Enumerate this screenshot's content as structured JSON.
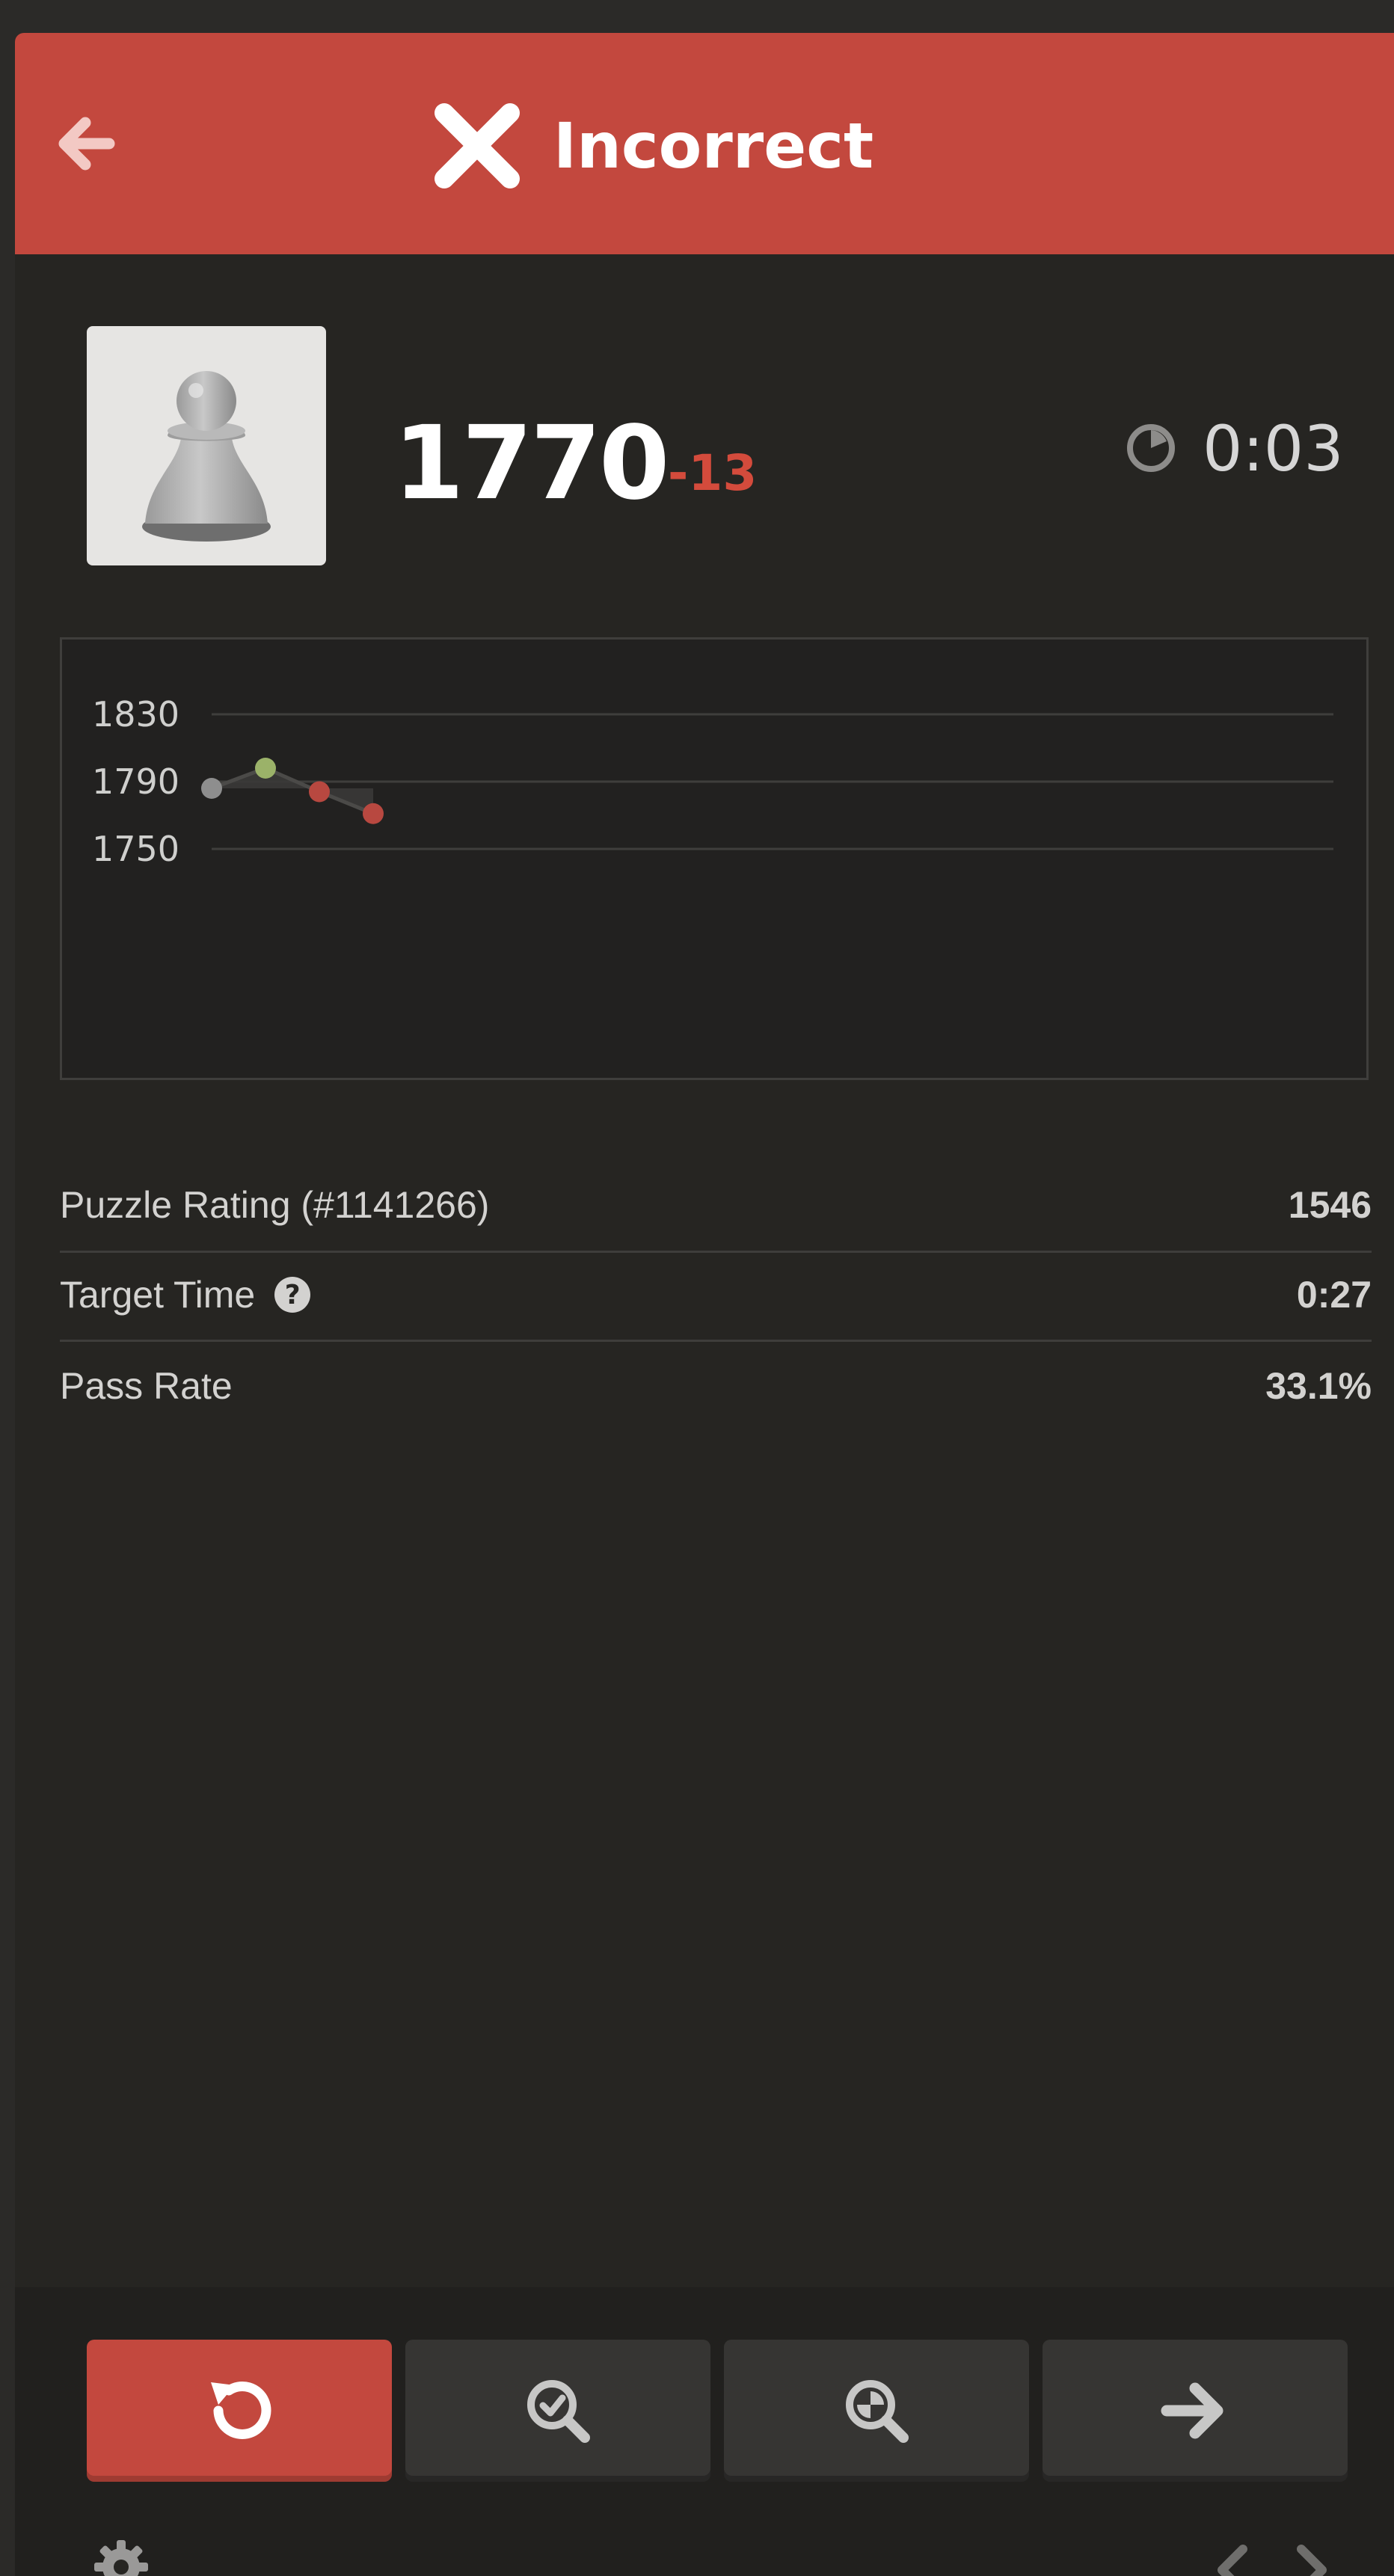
{
  "header": {
    "title": "Incorrect",
    "back_icon": "arrow-left-icon",
    "status_icon": "x-icon",
    "background_color": "#c3483e"
  },
  "player": {
    "avatar_icon": "pawn-icon",
    "rating": "1770",
    "rating_change": "-13",
    "rating_change_color": "#d44b3c",
    "time": "0:03",
    "timer_icon": "clock-icon"
  },
  "chart_data": {
    "type": "line",
    "y_ticks": [
      "1830",
      "1790",
      "1750"
    ],
    "ylim": [
      1740,
      1840
    ],
    "x": [
      1,
      2,
      3,
      4
    ],
    "values": [
      1786,
      1798,
      1784,
      1771
    ],
    "point_colors": [
      "#8e8e8e",
      "#9bb269",
      "#b84840",
      "#b84840"
    ],
    "xlabel": "",
    "ylabel": "",
    "grid": true
  },
  "stats": [
    {
      "label": "Puzzle Rating (#1141266)",
      "value": "1546"
    },
    {
      "label": "Target Time",
      "value": "0:27",
      "help_icon": "question-icon",
      "help_text": "?"
    },
    {
      "label": "Pass Rate",
      "value": "33.1%"
    }
  ],
  "actions": [
    {
      "icon": "retry-icon",
      "style": "primary"
    },
    {
      "icon": "analysis-check-icon",
      "style": "secondary"
    },
    {
      "icon": "analysis-zoom-icon",
      "style": "secondary"
    },
    {
      "icon": "arrow-right-icon",
      "style": "secondary"
    }
  ],
  "footer": {
    "settings_icon": "gear-icon",
    "prev_icon": "chevron-left-icon",
    "next_icon": "chevron-right-icon"
  }
}
